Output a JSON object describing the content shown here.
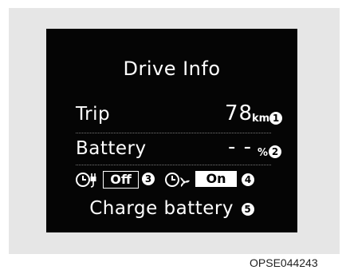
{
  "screen": {
    "title": "Drive Info",
    "trip": {
      "label": "Trip",
      "value": "78",
      "unit": "km",
      "callout": "1"
    },
    "battery": {
      "label": "Battery",
      "value": "- -",
      "unit": "%",
      "callout": "2"
    },
    "scheduled_charging": {
      "icon": "clock-plug-icon",
      "state": "Off",
      "callout": "3"
    },
    "scheduled_climate": {
      "icon": "clock-fan-icon",
      "state": "On",
      "callout": "4"
    },
    "message": {
      "text": "Charge battery",
      "callout": "5"
    }
  },
  "caption": "OPSE044243"
}
